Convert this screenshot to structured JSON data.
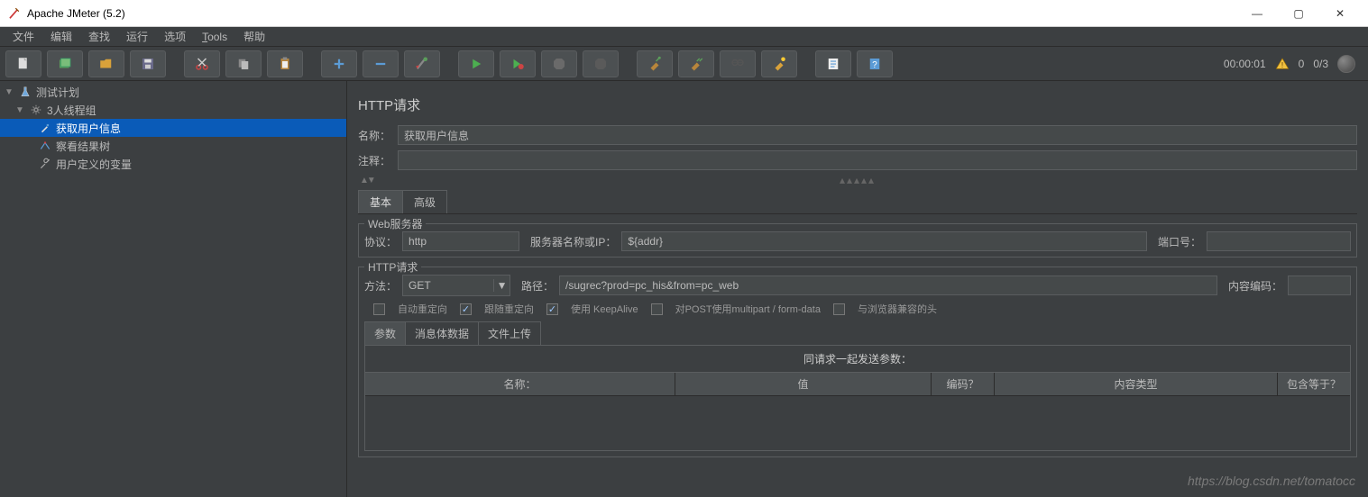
{
  "window": {
    "title": "Apache JMeter (5.2)"
  },
  "menu": [
    "文件",
    "编辑",
    "查找",
    "运行",
    "选项",
    "Tools",
    "帮助"
  ],
  "status": {
    "time": "00:00:01",
    "warn_count": "0",
    "threads": "0/3"
  },
  "tree": {
    "root": "测试计划",
    "group": "3人线程组",
    "items": [
      "获取用户信息",
      "察看结果树",
      "用户定义的变量"
    ]
  },
  "editor": {
    "heading": "HTTP请求",
    "name_label": "名称：",
    "name_value": "获取用户信息",
    "comment_label": "注释：",
    "comment_value": "",
    "tabs": [
      "基本",
      "高级"
    ],
    "webserver": {
      "legend": "Web服务器",
      "protocol_label": "协议：",
      "protocol_value": "http",
      "server_label": "服务器名称或IP：",
      "server_value": "${addr}",
      "port_label": "端口号：",
      "port_value": ""
    },
    "httpreq": {
      "legend": "HTTP请求",
      "method_label": "方法：",
      "method_value": "GET",
      "path_label": "路径：",
      "path_value": "/sugrec?prod=pc_his&from=pc_web",
      "encoding_label": "内容编码：",
      "encoding_value": ""
    },
    "checks": {
      "auto_redirect": "自动重定向",
      "follow_redirect": "跟随重定向",
      "keepalive": "使用 KeepAlive",
      "multipart": "对POST使用multipart / form-data",
      "browser_headers": "与浏览器兼容的头"
    },
    "ptabs": [
      "参数",
      "消息体数据",
      "文件上传"
    ],
    "ptable": {
      "caption": "同请求一起发送参数：",
      "cols": [
        "名称：",
        "值",
        "编码？",
        "内容类型",
        "包含等于？"
      ]
    }
  },
  "watermark": "https://blog.csdn.net/tomatocc"
}
